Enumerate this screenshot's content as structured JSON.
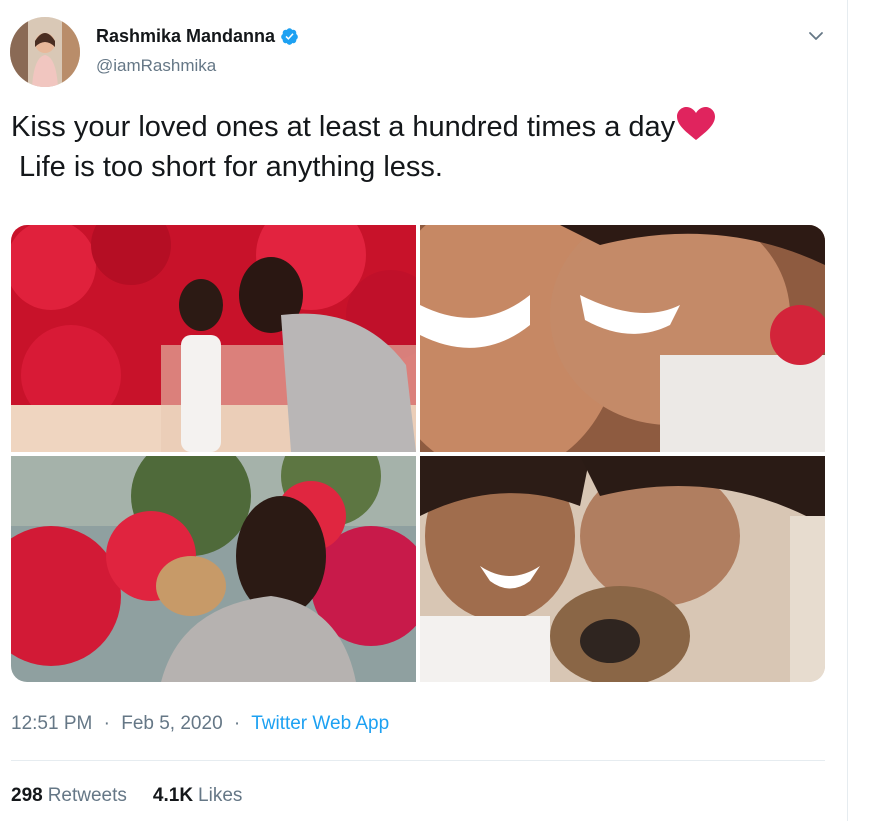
{
  "user": {
    "display_name": "Rashmika Mandanna",
    "handle": "@iamRashmika",
    "verified": true
  },
  "icons": {
    "verified": "verified-badge-icon",
    "menu": "chevron-down-icon",
    "emoji": "red-heart-emoji"
  },
  "tweet": {
    "line1": "Kiss your loved ones at least a hundred times a day",
    "line2": "Life is too short for anything less."
  },
  "meta": {
    "time": "12:51 PM",
    "date": "Feb 5, 2020",
    "separator": "·",
    "source": "Twitter Web App"
  },
  "stats": {
    "retweets_count": "298",
    "retweets_label": "Retweets",
    "likes_count": "4.1K",
    "likes_label": "Likes"
  },
  "colors": {
    "accent": "#1da1f2",
    "text_primary": "#14171a",
    "text_secondary": "#657786",
    "heart": "#e0245e"
  }
}
